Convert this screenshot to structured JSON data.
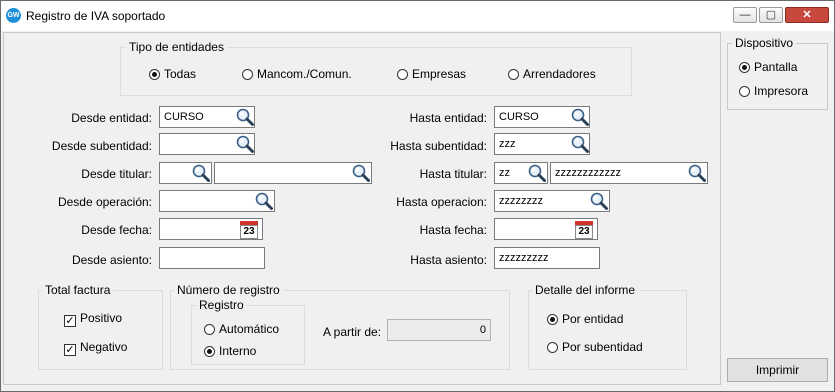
{
  "window": {
    "title": "Registro de IVA soportado",
    "app_icon_text": "GW",
    "controls": {
      "minimize": "—",
      "maximize": "▢",
      "close": "✕"
    }
  },
  "tipo_entidades": {
    "legend": "Tipo de entidades",
    "options": [
      "Todas",
      "Mancom./Comun.",
      "Empresas",
      "Arrendadores"
    ],
    "selected": "Todas"
  },
  "form": {
    "desde_entidad": {
      "label": "Desde entidad:",
      "value": "CURSO"
    },
    "desde_subentidad": {
      "label": "Desde subentidad:",
      "value": ""
    },
    "desde_titular": {
      "label": "Desde titular:",
      "value1": "",
      "value2": ""
    },
    "desde_operacion": {
      "label": "Desde operación:",
      "value": ""
    },
    "desde_fecha": {
      "label": "Desde fecha:",
      "value": ""
    },
    "desde_asiento": {
      "label": "Desde asiento:",
      "value": ""
    },
    "hasta_entidad": {
      "label": "Hasta entidad:",
      "value": "CURSO"
    },
    "hasta_subentidad": {
      "label": "Hasta subentidad:",
      "value": "zzz"
    },
    "hasta_titular": {
      "label": "Hasta titular:",
      "value1": "zz",
      "value2": "zzzzzzzzzzzz"
    },
    "hasta_operacion": {
      "label": "Hasta operacion:",
      "value": "zzzzzzzz"
    },
    "hasta_fecha": {
      "label": "Hasta fecha:",
      "value": ""
    },
    "hasta_asiento": {
      "label": "Hasta asiento:",
      "value": "zzzzzzzzz"
    },
    "calendar_day": "23"
  },
  "total_factura": {
    "legend": "Total factura",
    "positivo": {
      "label": "Positivo",
      "checked": true
    },
    "negativo": {
      "label": "Negativo",
      "checked": true
    }
  },
  "numero_registro": {
    "legend": "Número de registro",
    "registro_legend": "Registro",
    "options": [
      "Automático",
      "Interno"
    ],
    "selected": "Interno",
    "a_partir_label": "A partir de:",
    "a_partir_value": "0"
  },
  "detalle_informe": {
    "legend": "Detalle del informe",
    "options": [
      "Por entidad",
      "Por subentidad"
    ],
    "selected": "Por entidad"
  },
  "dispositivo": {
    "legend": "Dispositivo",
    "options": [
      "Pantalla",
      "Impresora"
    ],
    "selected": "Pantalla"
  },
  "imprimir_label": "Imprimir"
}
